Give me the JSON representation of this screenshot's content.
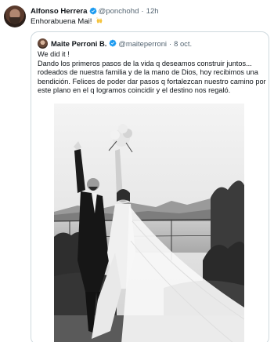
{
  "tweet": {
    "author_name": "Alfonso Herrera",
    "author_handle": "@ponchohd",
    "separator": "·",
    "time": "12h",
    "text": "Enhorabuena Mai!",
    "emoji_icon": "raising-hands-icon"
  },
  "quoted": {
    "author_name": "Maite Perroni B.",
    "author_handle": "@maiteperroni",
    "separator": "·",
    "time": "8 oct.",
    "lines": [
      "We did it !",
      "Dando los primeros pasos de la vida q deseamos construir juntos...",
      "rodeados de nuestra familia y de la mano de Dios, hoy recibimos una",
      "bendición. Felices de poder dar pasos q fortalezcan nuestro camino por",
      "este plano en el q logramos coincidir y el destino nos regaló."
    ],
    "media_icon": "wedding-photo"
  },
  "colors": {
    "text": "#0f1419",
    "secondary": "#536471",
    "verified": "#1d9bf0",
    "border": "#cfd9de"
  }
}
